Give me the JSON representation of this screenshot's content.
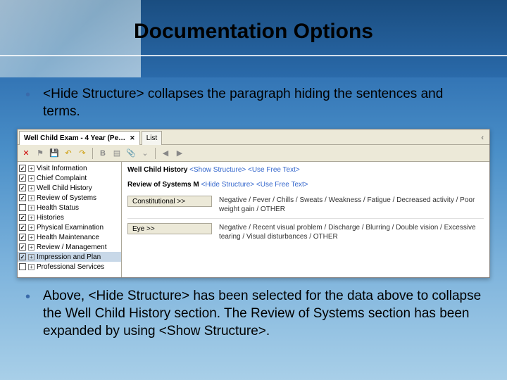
{
  "slide_title": "Documentation Options",
  "bullets": {
    "top": "<Hide Structure> collapses the paragraph hiding the sentences and terms.",
    "bottom": "Above, <Hide Structure> has been selected for the data above to collapse the Well Child History section.  The Review of Systems section has been expanded by using <Show Structure>."
  },
  "app": {
    "tabs": {
      "active": "Well Child Exam - 4 Year (Pe…",
      "list": "List"
    },
    "tree": [
      {
        "checked": true,
        "label": "Visit Information"
      },
      {
        "checked": true,
        "label": "Chief Complaint"
      },
      {
        "checked": true,
        "label": "Well Child History"
      },
      {
        "checked": true,
        "label": "Review of Systems"
      },
      {
        "checked": false,
        "label": "Health Status"
      },
      {
        "checked": true,
        "label": "Histories"
      },
      {
        "checked": true,
        "label": "Physical Examination"
      },
      {
        "checked": true,
        "label": "Health Maintenance"
      },
      {
        "checked": true,
        "label": "Review / Management"
      },
      {
        "checked": true,
        "label": "Impression and Plan",
        "selected": true
      },
      {
        "checked": false,
        "label": "Professional Services"
      }
    ],
    "detail": {
      "section1": {
        "title": "Well Child History",
        "link1": "<Show Structure>",
        "link2": "<Use Free Text>"
      },
      "section2": {
        "title": "Review of Systems",
        "mod": "M",
        "link1": "<Hide Structure>",
        "link2": "<Use Free Text>"
      },
      "rows": [
        {
          "btn": "Constitutional >>",
          "values": "Negative / Fever / Chills / Sweats / Weakness / Fatigue / Decreased activity / Poor weight gain / OTHER"
        },
        {
          "btn": "Eye >>",
          "values": "Negative / Recent visual problem / Discharge / Blurring / Double vision / Excessive tearing / Visual disturbances / OTHER"
        }
      ]
    }
  }
}
